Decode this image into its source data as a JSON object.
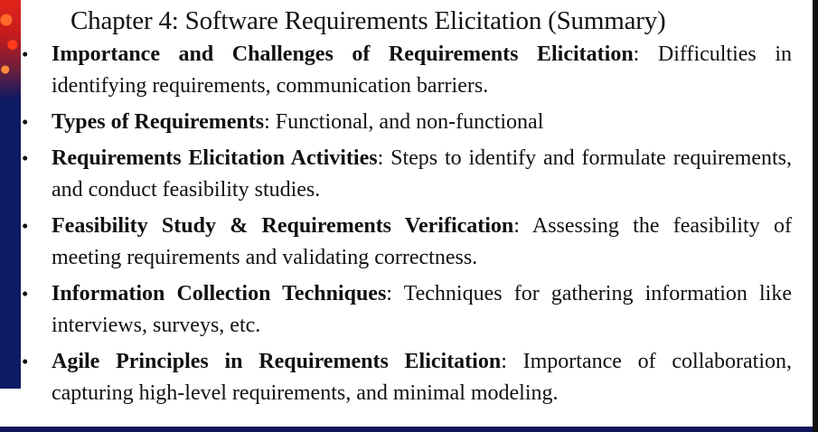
{
  "slide": {
    "title": "Chapter 4: Software Requirements Elicitation (Summary)",
    "bullet_glyph": "•",
    "bullets": [
      {
        "term": "Importance and Challenges of Requirements Elicitation",
        "text": ": Difficulties in identifying requirements, communication barriers."
      },
      {
        "term": "Types of Requirements",
        "text": ": Functional, and non-functional"
      },
      {
        "term": "Requirements Elicitation Activities",
        "text": ": Steps to identify and formulate requirements, and conduct feasibility studies."
      },
      {
        "term": "Feasibility Study & Requirements Verification",
        "text": ": Assessing the feasibility of meeting requirements and validating correctness."
      },
      {
        "term": "Information Collection Techniques",
        "text": ": Techniques for gathering information like interviews, surveys, etc."
      },
      {
        "term": "Agile Principles in Requirements Elicitation",
        "text": ": Importance of collaboration, capturing high-level requirements, and minimal modeling."
      }
    ]
  },
  "colors": {
    "text": "#111111",
    "side_band": "#0e1a63",
    "accent_red": "#e2251c",
    "bottom_rule": "#12145a"
  }
}
